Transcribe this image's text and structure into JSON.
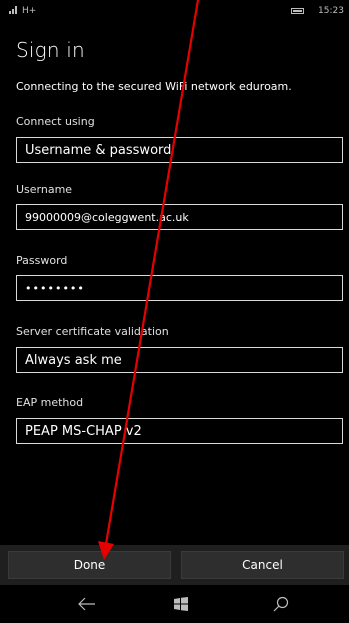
{
  "status_bar": {
    "network": "H+",
    "time": "15:23",
    "signal_icon": "signal-icon",
    "battery_icon": "battery-icon"
  },
  "title": "Sign in",
  "description": "Connecting to the secured WiFi network eduroam.",
  "fields": {
    "connect_using": {
      "label": "Connect using",
      "value": "Username & password"
    },
    "username": {
      "label": "Username",
      "value": "99000009@coleggwent.ac.uk"
    },
    "password": {
      "label": "Password",
      "value": "••••••••"
    },
    "server_cert": {
      "label": "Server certificate validation",
      "value": "Always ask me"
    },
    "eap_method": {
      "label": "EAP method",
      "value": "PEAP MS-CHAP v2"
    }
  },
  "app_bar": {
    "done_label": "Done",
    "cancel_label": "Cancel"
  },
  "nav_bar": {
    "back_icon": "back-arrow-icon",
    "start_icon": "windows-logo-icon",
    "search_icon": "search-icon"
  },
  "colors": {
    "background": "#000000",
    "text": "#ffffff",
    "field_border": "#d9d9d9",
    "app_bar": "#1f1f1f",
    "annotation_arrow": "#e60000"
  }
}
